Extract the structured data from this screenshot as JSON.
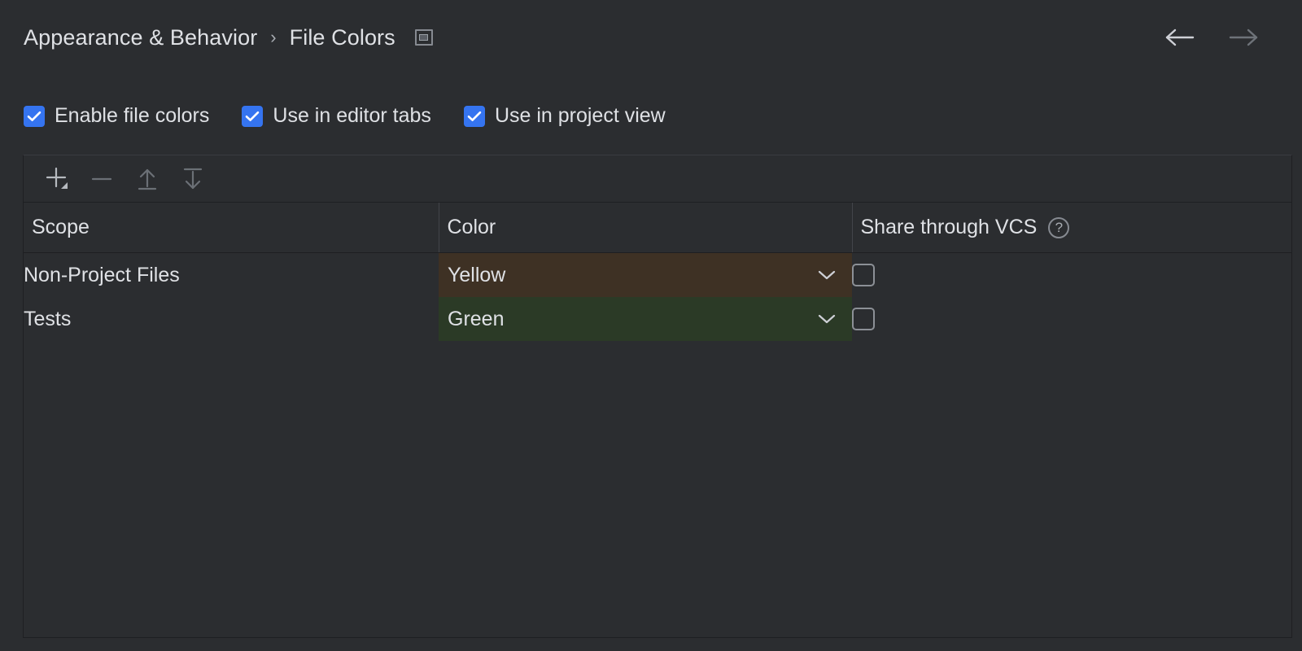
{
  "header": {
    "breadcrumb": {
      "parent": "Appearance & Behavior",
      "separator": "›",
      "current": "File Colors"
    },
    "window_icon_name": "window-icon",
    "back_label": "Back",
    "forward_label": "Forward"
  },
  "options": [
    {
      "label": "Enable file colors",
      "checked": true
    },
    {
      "label": "Use in editor tabs",
      "checked": true
    },
    {
      "label": "Use in project view",
      "checked": true
    }
  ],
  "toolbar": {
    "add_label": "Add",
    "remove_label": "Remove",
    "move_up_label": "Move Up",
    "move_down_label": "Move Down"
  },
  "table": {
    "columns": [
      "Scope",
      "Color",
      "Share through VCS"
    ],
    "help_glyph": "?",
    "rows": [
      {
        "scope": "Non-Project Files",
        "color": "Yellow",
        "color_bg": "#3e3124",
        "shared": false
      },
      {
        "scope": "Tests",
        "color": "Green",
        "color_bg": "#2b3a26",
        "shared": false
      }
    ]
  },
  "colors": {
    "background": "#2b2d30",
    "accent": "#3574f0",
    "text": "#dfe1e5",
    "border": "#1e1f22"
  }
}
